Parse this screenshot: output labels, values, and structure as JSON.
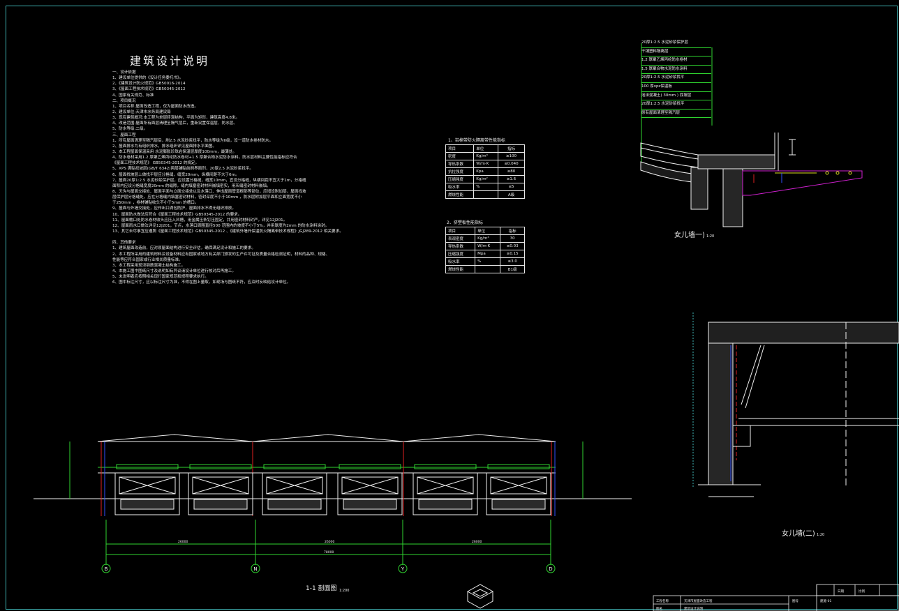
{
  "drawing": {
    "title": "建筑设计说明",
    "notes": [
      "一、设计依据",
      "1、建设单位提供的《设计任务委托书》。",
      "2、《建筑设计防火规范》GB50016-2014",
      "3、《屋面工程技术规范》GB50345-2012",
      "4、国家有关规范、标准",
      "二、项目概况",
      "1、项目名称:屋面改造工程，仅为屋面防水改造。",
      "2、建设单位:天津市水务局建设局",
      "3、现有建筑概况:本工程为单层砖混结构，平面为矩形，建筑高度4.8米。",
      "4、改造范围:屋面所有面层清理至隔气层后，重新设置保温层、防水层。",
      "5、防水等级:二级。",
      "三、屋面工程",
      "1、所有屋面清理至隔汽层后，刷2.5 水泥砂浆找平，防水等级为II级，设一道防水卷材防水。",
      "2、屋面排水为有组织排水，排水组织详见屋面排水平面图。",
      "3、本工程屋面保温采用 水泥膨胀珍珠岩保温层厚度100mm，最薄处。",
      "4、防水卷材采用1.2 厚聚乙烯丙纶防水卷材+1.5 厚聚合物水泥防水涂料，防水层材料主要性能指标应符合",
      "《屋面工程技术规范》 GB50345-2012 的规定。",
      "5、XPS 满贴找坡层(GB/T 6342)两层铺贴前刷界面剂，20厚2.5 水泥砂浆找平。",
      "6、屋面找坡层上做找平层应分格缝，缝宽20mm，纵横间距不大于6m。",
      "7、屋面20厚1:2.5 水泥砂浆保护层，应设置分格缝，缝宽10mm，宜设分格缝，纵横间距不宜大于1m，分格缝",
      "面积内应设分格缝宽度20mm 的缝隙，缝内填塞密封材料嵌填密实，用灰缝密封材料嵌填。",
      "8、天沟与屋面交接处、屋面平面与立面交接处以及水落口、伸出屋面管道根部等部位，应增设附加层，屋面找坡",
      "层保护层分格缝处，应在分格缝内填塞密封材料，密封深度不小于10mm ，防水层附加层平面和立面宽度不小",
      "于250mm ，卷材铺贴收头不小于5mm 的槽口。",
      "9、屋面与外墙交接处，应作出口滴包防护，屋面排水不得无组织排放。",
      "10、屋面防水做法应符合《屋面工程技术规范》GB50345-2012 的要求。",
      "11、屋面檐口处防水卷材收头应压入凹槽，用金属压条钉压固定，并用密封材料封严，详见12J201。",
      "12、屋面雨水口做法详见12J201，节点，水落口周围直径500 范围内的坡度不小于5%，并用厚度为2mm 的防水涂料涂封。",
      "13、其它未尽事宜应遵照《屋面工程技术规范》GB50345-2012 、《建筑外墙外保温防火隔离带技术规程》JGJ289-2012 相关要求。",
      "",
      "四、其他要求",
      "1、建筑屋面改造前，应对原屋面结构进行安全评估，确保满足设计和施工的要求。",
      "2、本工程所采用的建筑材料及设备材料应有国家或地方有关部门颁发的生产许可证及质量合格检测证明，材料的品种、规格、",
      "性能等应符合国家或行业相关质量标准。",
      "3、本工程采用现浇钢筋混凝土结构施工。",
      "4、本施工图中图纸尺寸及说明如有异议请设计单位进行核对后再施工。",
      "5、未说明者应按照相关现行国家规范和规程要求执行。",
      "6、图中标注尺寸，应以标注尺寸为准，不得在图上量取，如现场与图纸不符，应及时反映给设计单位。"
    ],
    "table1": {
      "caption": "1、岩棉带防火隔离带性能指标",
      "header": [
        "项目",
        "单位",
        "指标"
      ],
      "rows": [
        [
          "密度",
          "Kg/m³",
          "≥100"
        ],
        [
          "导热系数",
          "W/m·K",
          "≤0.040"
        ],
        [
          "抗拉强度",
          "Kpa",
          "≥80"
        ],
        [
          "压缩强度",
          "Kg/m²",
          "≥1.6"
        ],
        [
          "吸水率",
          "%",
          "≤5"
        ],
        [
          "燃烧性能",
          "",
          "A级"
        ]
      ]
    },
    "table2": {
      "caption": "2、挤塑板性能指标",
      "header": [
        "项目",
        "单位",
        "指标"
      ],
      "rows": [
        [
          "表观密度",
          "Kg/m³",
          "30"
        ],
        [
          "导热系数",
          "W/m·K",
          "≤0.03"
        ],
        [
          "压缩强度",
          "Mpa",
          "≥0.15"
        ],
        [
          "吸水率",
          "%",
          "≤3.0"
        ],
        [
          "燃烧性能",
          "",
          "B1级"
        ]
      ]
    },
    "detail1": {
      "label": "女儿墙一)",
      "scale": "1:20",
      "layers": [
        "20厚1:2.5 水泥砂浆保护层",
        "干铺塑料隔离层",
        "1.2 厚聚乙烯丙纶防水卷材",
        "1.5 厚聚合物水泥防水涂料",
        "20厚1:2.5 水泥砂浆找平",
        "100 厚xps保温板",
        "泡沫混凝土( 30mm ) 找坡层",
        "20厚1:2.5 水泥砂浆找平",
        "原有屋面清理至隔汽层"
      ]
    },
    "detail2": {
      "label": "女儿墙(二)",
      "scale": "1:20"
    },
    "section": {
      "label": "1-1 剖面图",
      "scale": "1:200",
      "axes": [
        "B",
        "N",
        "Y",
        "D"
      ],
      "dims": [
        "26000",
        "26000",
        "26000",
        "78000"
      ]
    },
    "titleblock": {
      "cells": [
        "工程名称",
        "天津市屋面改造工程",
        "图号",
        "建施-01",
        "图名",
        "建筑设计说明",
        "日期",
        "比例"
      ]
    }
  },
  "colors": {
    "background": "#000000",
    "frame": "#3fb3b3",
    "green": "#2fd42f",
    "red": "#e02020",
    "magenta": "#d020d0",
    "white": "#f0f0f0",
    "yellow": "#e0e020",
    "blue": "#3050ff",
    "cyan": "#30d0d0"
  }
}
